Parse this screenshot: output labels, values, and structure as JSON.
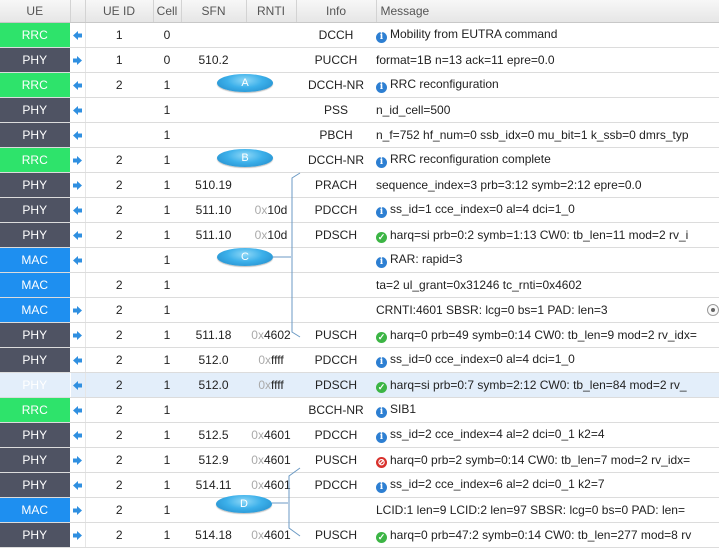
{
  "columns": [
    "UE",
    "",
    "UE ID",
    "Cell",
    "SFN",
    "RNTI",
    "Info",
    "Message"
  ],
  "colors": {
    "RRC": "#2ee36b",
    "PHY": "#4f5363",
    "MAC": "#1e8ff0",
    "arrow": "#2f8fe0",
    "bubble": "#3cb0ea"
  },
  "rows": [
    {
      "layer": "RRC",
      "dir": "dl",
      "ue_id": "1",
      "cell": "0",
      "sfn": "",
      "rnti_prefix": "",
      "rnti": "",
      "info": "DCCH",
      "icon": "info",
      "message": "Mobility from EUTRA command"
    },
    {
      "layer": "PHY",
      "dir": "ul",
      "ue_id": "1",
      "cell": "0",
      "sfn": "510.2",
      "rnti_prefix": "",
      "rnti": "",
      "info": "PUCCH",
      "icon": "",
      "message": "format=1B n=13 ack=11 epre=0.0"
    },
    {
      "layer": "RRC",
      "dir": "dl",
      "ue_id": "2",
      "cell": "1",
      "sfn": "",
      "rnti_prefix": "",
      "rnti": "",
      "info": "DCCH-NR",
      "icon": "info",
      "message": "RRC reconfiguration"
    },
    {
      "layer": "PHY",
      "dir": "dl",
      "ue_id": "",
      "cell": "1",
      "sfn": "",
      "rnti_prefix": "",
      "rnti": "",
      "info": "PSS",
      "icon": "",
      "message": "n_id_cell=500"
    },
    {
      "layer": "PHY",
      "dir": "dl",
      "ue_id": "",
      "cell": "1",
      "sfn": "",
      "rnti_prefix": "",
      "rnti": "",
      "info": "PBCH",
      "icon": "",
      "message": "n_f=752 hf_num=0 ssb_idx=0 mu_bit=1 k_ssb=0 dmrs_typ"
    },
    {
      "layer": "RRC",
      "dir": "ul",
      "ue_id": "2",
      "cell": "1",
      "sfn": "",
      "rnti_prefix": "",
      "rnti": "",
      "info": "DCCH-NR",
      "icon": "info",
      "message": "RRC reconfiguration complete"
    },
    {
      "layer": "PHY",
      "dir": "ul",
      "ue_id": "2",
      "cell": "1",
      "sfn": "510.19",
      "rnti_prefix": "",
      "rnti": "",
      "info": "PRACH",
      "icon": "",
      "message": "sequence_index=3 prb=3:12 symb=2:12 epre=0.0"
    },
    {
      "layer": "PHY",
      "dir": "dl",
      "ue_id": "2",
      "cell": "1",
      "sfn": "511.10",
      "rnti_prefix": "0x",
      "rnti": "10d",
      "info": "PDCCH",
      "icon": "info",
      "message": "ss_id=1 cce_index=0 al=4 dci=1_0"
    },
    {
      "layer": "PHY",
      "dir": "dl",
      "ue_id": "2",
      "cell": "1",
      "sfn": "511.10",
      "rnti_prefix": "0x",
      "rnti": "10d",
      "info": "PDSCH",
      "icon": "ok",
      "message": "harq=si prb=0:2 symb=1:13 CW0: tb_len=11 mod=2 rv_i"
    },
    {
      "layer": "MAC",
      "dir": "dl",
      "ue_id": "",
      "cell": "1",
      "sfn": "",
      "rnti_prefix": "",
      "rnti": "",
      "info": "",
      "icon": "info",
      "message": "RAR: rapid=3"
    },
    {
      "layer": "MAC",
      "dir": "",
      "ue_id": "2",
      "cell": "1",
      "sfn": "",
      "rnti_prefix": "",
      "rnti": "",
      "info": "",
      "icon": "",
      "message": "ta=2 ul_grant=0x31246 tc_rnti=0x4602"
    },
    {
      "layer": "MAC",
      "dir": "ul",
      "ue_id": "2",
      "cell": "1",
      "sfn": "",
      "rnti_prefix": "",
      "rnti": "",
      "info": "",
      "icon": "",
      "message": "CRNTI:4601 SBSR: lcg=0 bs=1 PAD: len=3"
    },
    {
      "layer": "PHY",
      "dir": "ul",
      "ue_id": "2",
      "cell": "1",
      "sfn": "511.18",
      "rnti_prefix": "0x",
      "rnti": "4602",
      "info": "PUSCH",
      "icon": "ok",
      "message": "harq=0 prb=49 symb=0:14 CW0: tb_len=9 mod=2 rv_idx="
    },
    {
      "layer": "PHY",
      "dir": "dl",
      "ue_id": "2",
      "cell": "1",
      "sfn": "512.0",
      "rnti_prefix": "0x",
      "rnti": "ffff",
      "info": "PDCCH",
      "icon": "info",
      "message": "ss_id=0 cce_index=0 al=4 dci=1_0"
    },
    {
      "layer": "PHY",
      "dir": "dl",
      "ue_id": "2",
      "cell": "1",
      "sfn": "512.0",
      "rnti_prefix": "0x",
      "rnti": "ffff",
      "info": "PDSCH",
      "icon": "ok",
      "message": "harq=si prb=0:7 symb=2:12 CW0: tb_len=84 mod=2 rv_",
      "highlight": true
    },
    {
      "layer": "RRC",
      "dir": "dl",
      "ue_id": "2",
      "cell": "1",
      "sfn": "",
      "rnti_prefix": "",
      "rnti": "",
      "info": "BCCH-NR",
      "icon": "info",
      "message": "SIB1"
    },
    {
      "layer": "PHY",
      "dir": "dl",
      "ue_id": "2",
      "cell": "1",
      "sfn": "512.5",
      "rnti_prefix": "0x",
      "rnti": "4601",
      "info": "PDCCH",
      "icon": "info",
      "message": "ss_id=2 cce_index=4 al=2 dci=0_1 k2=4"
    },
    {
      "layer": "PHY",
      "dir": "ul",
      "ue_id": "2",
      "cell": "1",
      "sfn": "512.9",
      "rnti_prefix": "0x",
      "rnti": "4601",
      "info": "PUSCH",
      "icon": "err",
      "message": "harq=0 prb=2 symb=0:14 CW0: tb_len=7 mod=2 rv_idx="
    },
    {
      "layer": "PHY",
      "dir": "dl",
      "ue_id": "2",
      "cell": "1",
      "sfn": "514.11",
      "rnti_prefix": "0x",
      "rnti": "4601",
      "info": "PDCCH",
      "icon": "info",
      "message": "ss_id=2 cce_index=6 al=2 dci=0_1 k2=7"
    },
    {
      "layer": "MAC",
      "dir": "ul",
      "ue_id": "2",
      "cell": "1",
      "sfn": "",
      "rnti_prefix": "",
      "rnti": "",
      "info": "",
      "icon": "",
      "message": "LCID:1 len=9 LCID:2 len=97 SBSR: lcg=0 bs=0 PAD: len="
    },
    {
      "layer": "PHY",
      "dir": "ul",
      "ue_id": "2",
      "cell": "1",
      "sfn": "514.18",
      "rnti_prefix": "0x",
      "rnti": "4601",
      "info": "PUSCH",
      "icon": "ok",
      "message": "harq=0 prb=47:2 symb=0:14 CW0: tb_len=277 mod=8 rv"
    }
  ],
  "annotations": [
    "A",
    "B",
    "C",
    "D"
  ]
}
